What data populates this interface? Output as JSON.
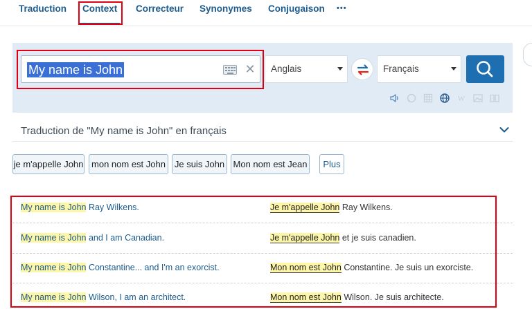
{
  "nav": {
    "tabs": [
      {
        "label": "Traduction"
      },
      {
        "label": "Context"
      },
      {
        "label": "Correcteur"
      },
      {
        "label": "Synonymes"
      },
      {
        "label": "Conjugaison"
      }
    ],
    "more_label": "•••"
  },
  "search": {
    "value": "My name is John",
    "source_lang": "Anglais",
    "target_lang": "Français"
  },
  "tools": [
    "speaker-icon",
    "chat-icon",
    "grid-icon",
    "globe-icon",
    "wikipedia-icon",
    "image-icon",
    "book-icon"
  ],
  "translation_header": "Traduction de \"My name is John\" en français",
  "suggestions": [
    {
      "label": "je m'appelle John"
    },
    {
      "label": "mon nom est John"
    },
    {
      "label": "Je suis John"
    },
    {
      "label": "Mon nom est Jean"
    }
  ],
  "more_button": "Plus",
  "examples": [
    {
      "src_mark": "My name is John",
      "src_rest": " Ray Wilkens.",
      "tgt_mark": "Je m'appelle John",
      "tgt_rest": " Ray Wilkens."
    },
    {
      "src_mark": "My name is John",
      "src_rest": " and I am Canadian.",
      "tgt_mark": "Je m'appelle John",
      "tgt_rest": " et je suis canadien."
    },
    {
      "src_mark": "My name is John",
      "src_rest": " Constantine... and I'm an exorcist.",
      "tgt_mark": "Mon nom est John",
      "tgt_rest": " Constantine. Je suis un exorciste."
    },
    {
      "src_mark": "My name is John",
      "src_rest": " Wilson, I am an architect.",
      "tgt_mark": "Mon nom est John",
      "tgt_rest": " Wilson. Je suis architecte."
    }
  ],
  "colors": {
    "brand": "#1d5b8c",
    "search_button": "#1d6fb1",
    "panel": "#e1ebf5",
    "highlight": "#fdf6a8",
    "annotation_box": "#e10012"
  }
}
